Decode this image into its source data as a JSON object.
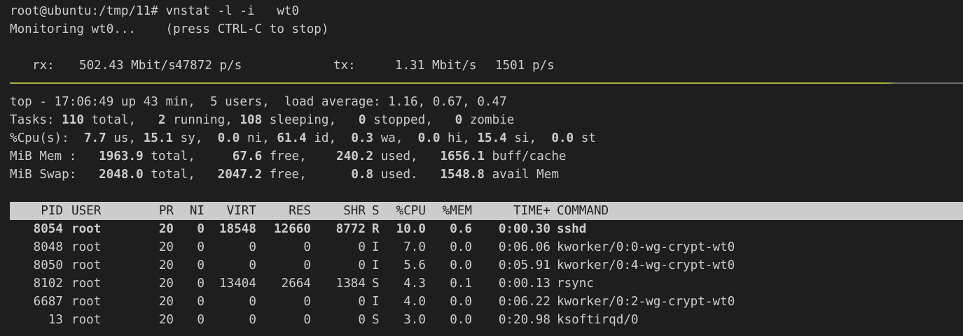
{
  "vnstat": {
    "prompt": "root@ubuntu:/tmp/11#",
    "command": "vnstat -l -i   wt0",
    "monitoring": "Monitoring wt0...    (press CTRL-C to stop)",
    "rx_label": "rx:",
    "rx_rate": "502.43 Mbit/s",
    "rx_pps": "47872 p/s",
    "tx_label": "tx:",
    "tx_rate": "1.31 Mbit/s",
    "tx_pps": "1501 p/s"
  },
  "top": {
    "summary": "top - 17:06:49 up 43 min,  5 users,  load average: 1.16, 0.67, 0.47",
    "tasks": {
      "label": "Tasks:",
      "total": "110",
      "total_label": "total,",
      "running": "2",
      "running_label": "running,",
      "sleeping": "108",
      "sleeping_label": "sleeping,",
      "stopped": "0",
      "stopped_label": "stopped,",
      "zombie": "0",
      "zombie_label": "zombie"
    },
    "cpu": {
      "label": "%Cpu(s):",
      "us": "7.7",
      "us_label": "us,",
      "sy": "15.1",
      "sy_label": "sy,",
      "ni": "0.0",
      "ni_label": "ni,",
      "id": "61.4",
      "id_label": "id,",
      "wa": "0.3",
      "wa_label": "wa,",
      "hi": "0.0",
      "hi_label": "hi,",
      "si": "15.4",
      "si_label": "si,",
      "st": "0.0",
      "st_label": "st"
    },
    "mem": {
      "label": "MiB Mem :",
      "total": "1963.9",
      "total_label": "total,",
      "free": "67.6",
      "free_label": "free,",
      "used": "240.2",
      "used_label": "used,",
      "buff": "1656.1",
      "buff_label": "buff/cache"
    },
    "swap": {
      "label": "MiB Swap:",
      "total": "2048.0",
      "total_label": "total,",
      "free": "2047.2",
      "free_label": "free,",
      "used": "0.8",
      "used_label": "used.",
      "avail": "1548.8",
      "avail_label": "avail Mem"
    },
    "columns": {
      "pid": "PID",
      "user": "USER",
      "pr": "PR",
      "ni": "NI",
      "virt": "VIRT",
      "res": "RES",
      "shr": "SHR",
      "s": "S",
      "cpu": "%CPU",
      "mem": "%MEM",
      "time": "TIME+",
      "command": "COMMAND"
    },
    "processes": [
      {
        "pid": "8054",
        "user": "root",
        "pr": "20",
        "ni": "0",
        "virt": "18548",
        "res": "12660",
        "shr": "8772",
        "s": "R",
        "cpu": "10.0",
        "mem": "0.6",
        "time": "0:00.30",
        "command": "sshd"
      },
      {
        "pid": "8048",
        "user": "root",
        "pr": "20",
        "ni": "0",
        "virt": "0",
        "res": "0",
        "shr": "0",
        "s": "I",
        "cpu": "7.0",
        "mem": "0.0",
        "time": "0:06.06",
        "command": "kworker/0:0-wg-crypt-wt0"
      },
      {
        "pid": "8050",
        "user": "root",
        "pr": "20",
        "ni": "0",
        "virt": "0",
        "res": "0",
        "shr": "0",
        "s": "I",
        "cpu": "5.6",
        "mem": "0.0",
        "time": "0:05.91",
        "command": "kworker/0:4-wg-crypt-wt0"
      },
      {
        "pid": "8102",
        "user": "root",
        "pr": "20",
        "ni": "0",
        "virt": "13404",
        "res": "2664",
        "shr": "1384",
        "s": "S",
        "cpu": "4.3",
        "mem": "0.1",
        "time": "0:00.13",
        "command": "rsync"
      },
      {
        "pid": "6687",
        "user": "root",
        "pr": "20",
        "ni": "0",
        "virt": "0",
        "res": "0",
        "shr": "0",
        "s": "I",
        "cpu": "4.0",
        "mem": "0.0",
        "time": "0:06.22",
        "command": "kworker/0:2-wg-crypt-wt0"
      },
      {
        "pid": "13",
        "user": "root",
        "pr": "20",
        "ni": "0",
        "virt": "0",
        "res": "0",
        "shr": "0",
        "s": "S",
        "cpu": "3.0",
        "mem": "0.0",
        "time": "0:20.98",
        "command": "ksoftirqd/0"
      }
    ]
  },
  "colors": {
    "background": "#1e1e1e",
    "foreground": "#cccccc",
    "separator": "#a9b23a",
    "header_bg": "#cccccc"
  }
}
